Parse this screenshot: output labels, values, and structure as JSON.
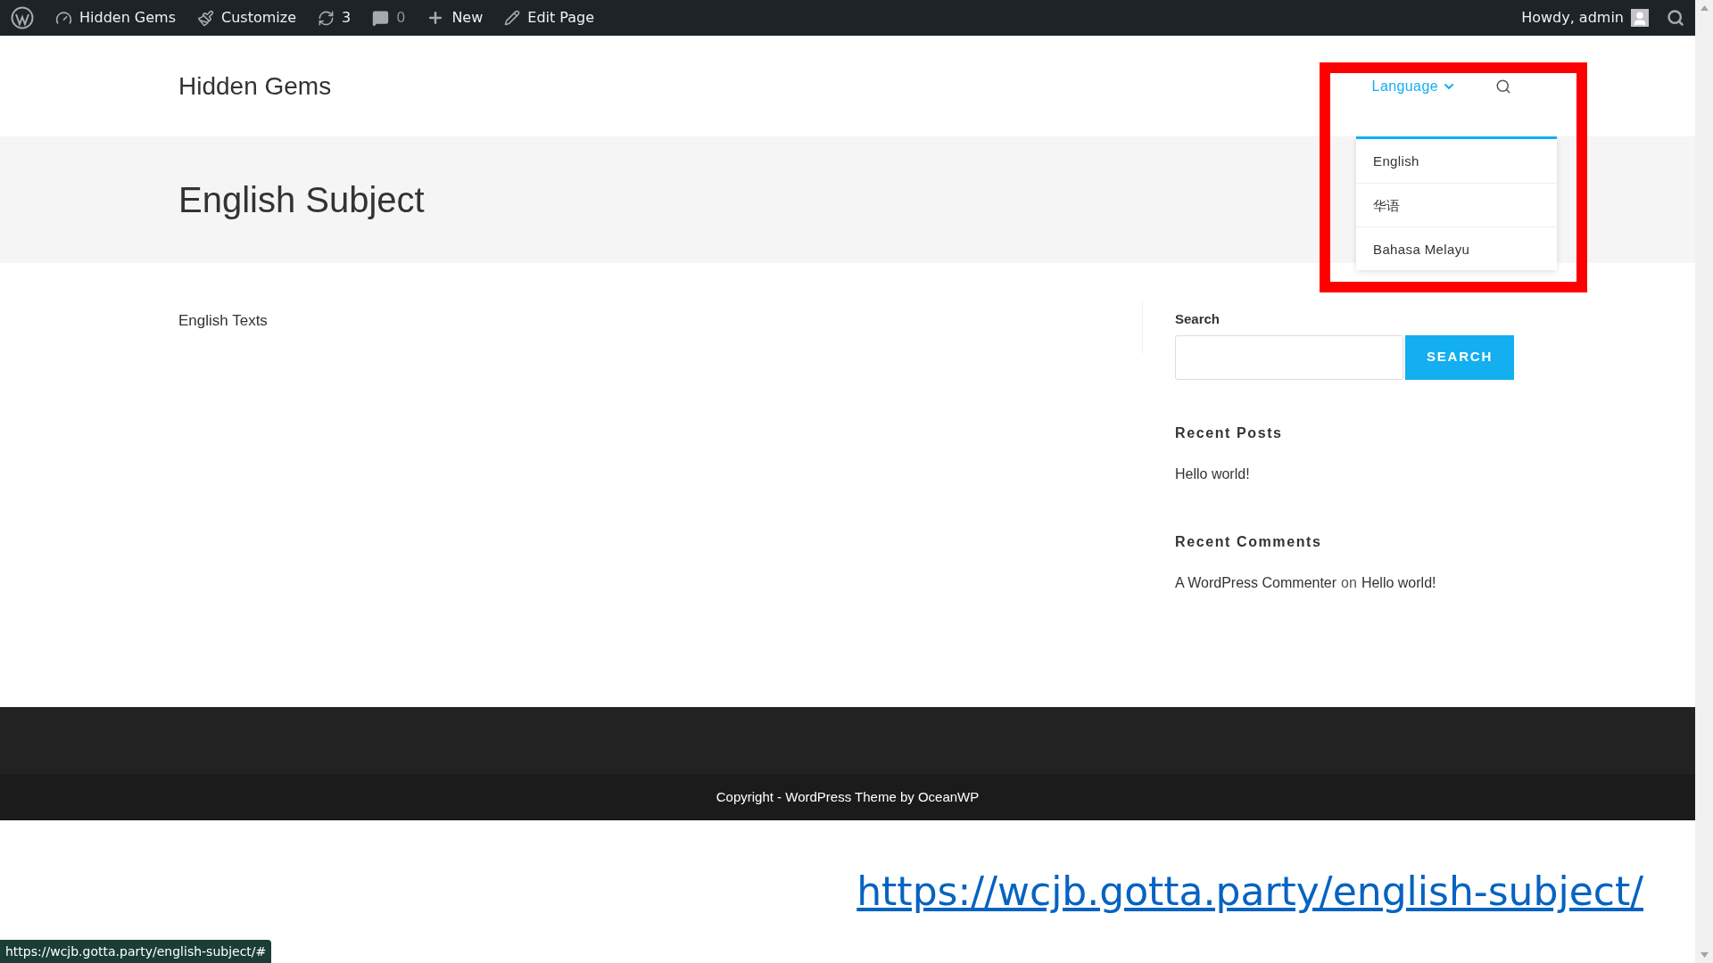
{
  "admin_bar": {
    "items": [
      {
        "kind": "logo"
      },
      {
        "kind": "site",
        "label": "Hidden Gems"
      },
      {
        "kind": "customize",
        "label": "Customize"
      },
      {
        "kind": "updates",
        "label": "3"
      },
      {
        "kind": "comments",
        "label": "0"
      },
      {
        "kind": "new",
        "label": "New"
      },
      {
        "kind": "edit",
        "label": "Edit Page"
      }
    ],
    "greeting": "Howdy, admin"
  },
  "header": {
    "site_title": "Hidden Gems",
    "nav": {
      "label": "Language",
      "expanded": true,
      "options": [
        {
          "label": "English"
        },
        {
          "label": "华语"
        },
        {
          "label": "Bahasa Melayu"
        }
      ]
    }
  },
  "page_title": "English Subject",
  "content": {
    "text": "English Texts"
  },
  "sidebar": {
    "search": {
      "title": "Search",
      "button": "SEARCH"
    },
    "recent_posts": {
      "title": "Recent Posts",
      "items": [
        "Hello world!"
      ]
    },
    "recent_comments": {
      "title": "Recent Comments",
      "items": [
        {
          "author": "A WordPress Commenter",
          "joiner": "on",
          "post": "Hello world!"
        }
      ]
    }
  },
  "footer": {
    "copyright": "Copyright - WordPress Theme by OceanWP"
  },
  "annotation": {
    "url": "https://wcjb.gotta.party/english-subject/"
  },
  "status_bar": {
    "url": "https://wcjb.gotta.party/english-subject/#"
  }
}
